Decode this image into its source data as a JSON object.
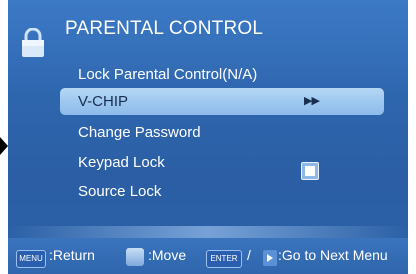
{
  "menu": {
    "title": "PARENTAL CONTROL",
    "items": [
      {
        "label": "Lock Parental Control(N/A)"
      },
      {
        "label": "V-CHIP",
        "indicator": "▶▶",
        "selected": true
      },
      {
        "label": "Change Password"
      },
      {
        "label": "Keypad Lock",
        "toggle": "off"
      },
      {
        "label": "Source Lock"
      }
    ]
  },
  "footer": {
    "menu_key": "MENU",
    "menu_action": ":Return",
    "move_action": ":Move",
    "enter_key": "ENTER",
    "enter_separator": "/",
    "enter_action": ":Go to Next Menu"
  },
  "icons": {
    "header": "lock-icon",
    "move": "dpad-icon",
    "next": "right-arrow-icon",
    "left_pointer": "left-triangle-icon"
  },
  "colors": {
    "panel": "#2e66ae",
    "selection": "#a6ccf0",
    "text": "#ffffff",
    "selected_text": "#1a2e50"
  }
}
